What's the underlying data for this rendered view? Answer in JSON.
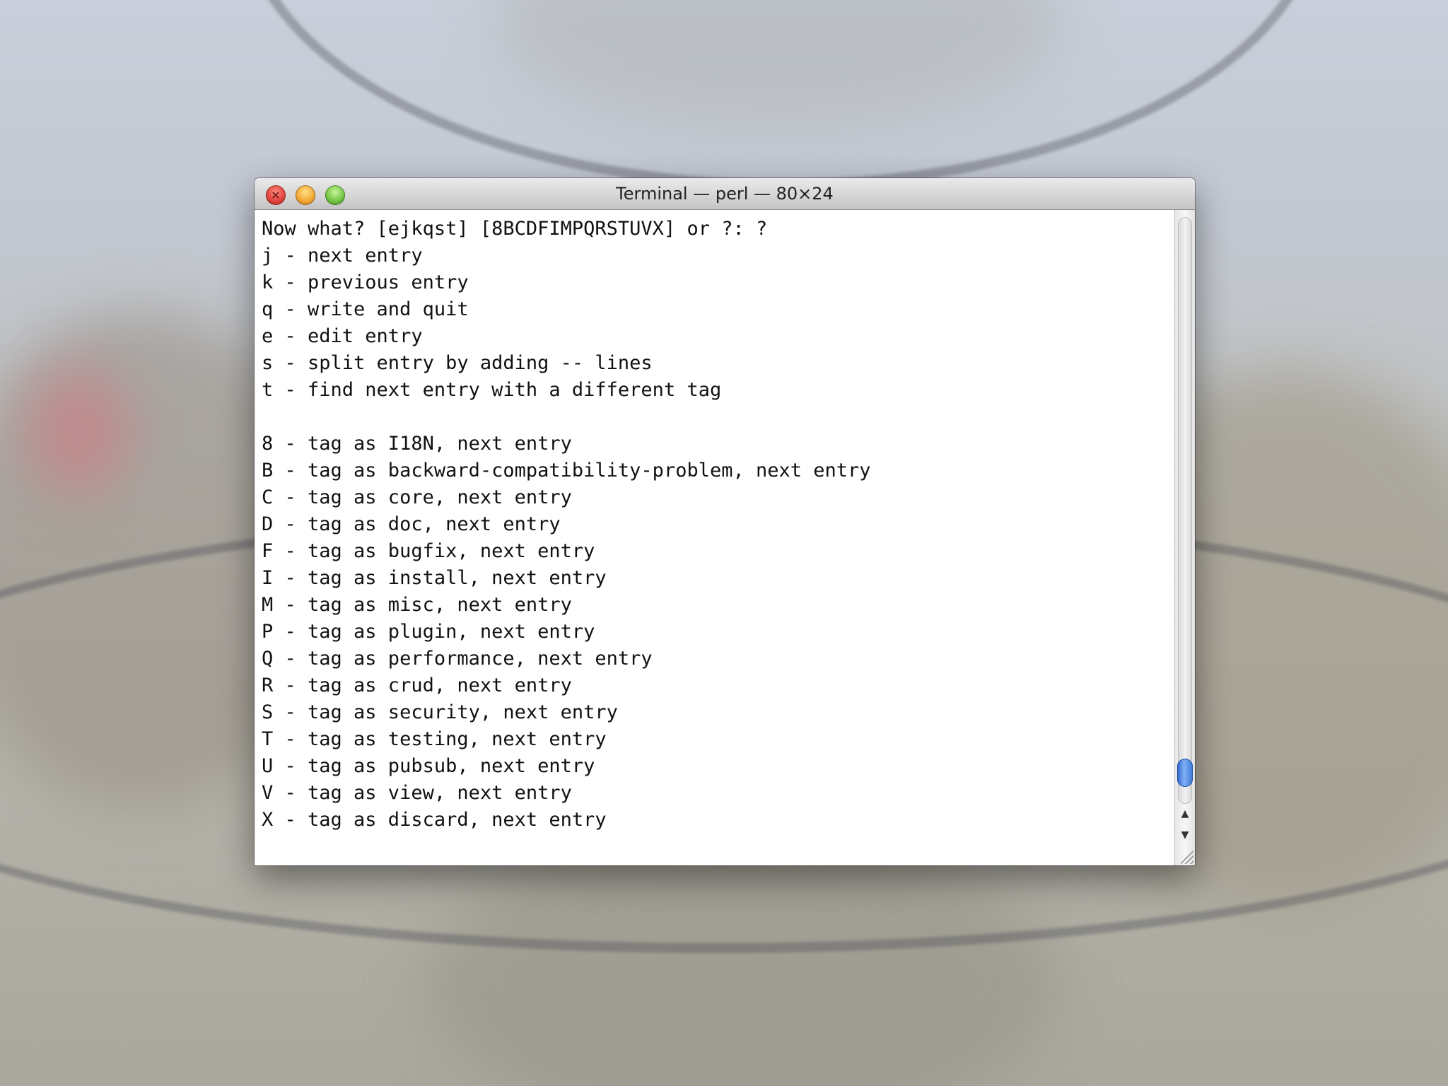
{
  "window": {
    "title": "Terminal — perl — 80×24",
    "controls": {
      "close_glyph": "×",
      "minimize_glyph": "–",
      "zoom_glyph": "+"
    }
  },
  "terminal": {
    "lines": [
      "Now what? [ejkqst] [8BCDFIMPQRSTUVX] or ?: ?",
      "j - next entry",
      "k - previous entry",
      "q - write and quit",
      "e - edit entry",
      "s - split entry by adding -- lines",
      "t - find next entry with a different tag",
      "",
      "8 - tag as I18N, next entry",
      "B - tag as backward-compatibility-problem, next entry",
      "C - tag as core, next entry",
      "D - tag as doc, next entry",
      "F - tag as bugfix, next entry",
      "I - tag as install, next entry",
      "M - tag as misc, next entry",
      "P - tag as plugin, next entry",
      "Q - tag as performance, next entry",
      "R - tag as crud, next entry",
      "S - tag as security, next entry",
      "T - tag as testing, next entry",
      "U - tag as pubsub, next entry",
      "V - tag as view, next entry",
      "X - tag as discard, next entry"
    ]
  },
  "scrollbar": {
    "up_arrow": "▲",
    "down_arrow": "▼",
    "position_fraction": 0.97
  },
  "colors": {
    "close": "#e0443b",
    "minimize": "#f2a833",
    "zoom": "#73c544",
    "scroll_thumb": "#3b78d6"
  }
}
